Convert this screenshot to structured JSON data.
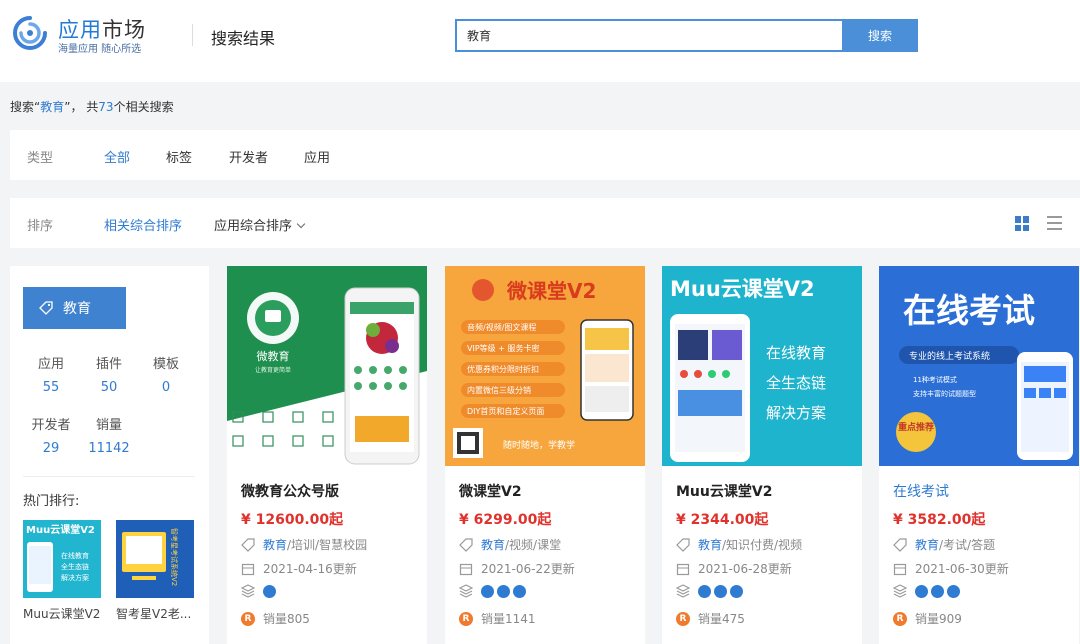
{
  "header": {
    "logo_title": "应用",
    "logo_title_2": "市场",
    "logo_subtitle": "海量应用  随心所选",
    "page_title": "搜索结果",
    "search": {
      "value": "教育",
      "button_label": "搜索"
    }
  },
  "summary": {
    "prefix": "搜索“",
    "keyword": "教育",
    "middle": "”，  共",
    "count": "73",
    "suffix": "个相关搜索"
  },
  "filter": {
    "label": "类型",
    "items": [
      {
        "label": "全部",
        "active": true
      },
      {
        "label": "标签",
        "active": false
      },
      {
        "label": "开发者",
        "active": false
      },
      {
        "label": "应用",
        "active": false
      }
    ]
  },
  "sort": {
    "label": "排序",
    "items": [
      {
        "label": "相关综合排序",
        "active": true
      },
      {
        "label": "应用综合排序",
        "active": false
      }
    ]
  },
  "sidebar": {
    "tag_label": "教育",
    "stats": [
      {
        "label": "应用",
        "value": "55"
      },
      {
        "label": "插件",
        "value": "50"
      },
      {
        "label": "模板",
        "value": "0"
      },
      {
        "label": "开发者",
        "value": "29"
      },
      {
        "label": "销量",
        "value": "11142"
      }
    ],
    "hot_title": "热门排行:",
    "hot_items": [
      {
        "name": "Muu云课堂V2",
        "thumb_title": "Muu云课堂V2",
        "thumb_lines": [
          "在线教育",
          "全生态链",
          "解决方案"
        ]
      },
      {
        "name": "智考星V2老...",
        "thumb_title": "智考星考试系统V2"
      }
    ]
  },
  "cards": [
    {
      "name": "微教育公众号版",
      "price": "¥ 12600.00起",
      "tag_primary": "教育",
      "tag_rest": "/培训/智慧校园",
      "date": "2021-04-16更新",
      "sales": "销量805",
      "thumb": {
        "app_name": "微教育",
        "app_slogan": "让教育更简单"
      }
    },
    {
      "name": "微课堂V2",
      "price": "¥ 6299.00起",
      "tag_primary": "教育",
      "tag_rest": "/视频/课堂",
      "date": "2021-06-22更新",
      "sales": "销量1141",
      "thumb": {
        "title": "微课堂V2",
        "features": [
          "音频/视频/图文课程",
          "VIP等级 + 服务卡密",
          "优惠券积分限时折扣",
          "内置微信三级分销",
          "DIY首页和自定义页面"
        ],
        "footer": "随时随地，学教学"
      }
    },
    {
      "name": "Muu云课堂V2",
      "price": "¥ 2344.00起",
      "tag_primary": "教育",
      "tag_rest": "/知识付费/视频",
      "date": "2021-06-28更新",
      "sales": "销量475",
      "thumb": {
        "title": "Muu云课堂V2",
        "lines": [
          "在线教育",
          "全生态链",
          "解决方案"
        ]
      }
    },
    {
      "name": "在线考试",
      "price": "¥ 3582.00起",
      "tag_primary": "教育",
      "tag_rest": "/考试/答题",
      "date": "2021-06-30更新",
      "sales": "销量909",
      "thumb": {
        "title": "在线考试",
        "subtitle": "专业的线上考试系统",
        "bullets": [
          "11种考试模式",
          "支持丰富的试题题型"
        ],
        "badge": "重点推荐"
      }
    }
  ]
}
